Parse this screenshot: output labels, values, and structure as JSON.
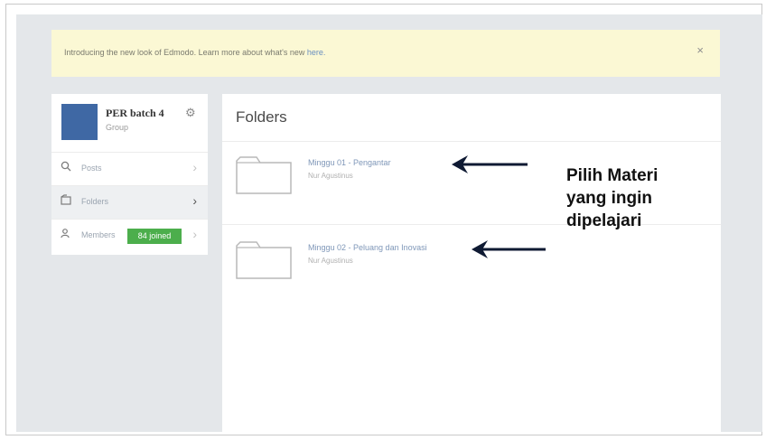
{
  "notice": {
    "text": "Introducing the new look of Edmodo. Learn more about what's new",
    "link": "here.",
    "close": "×"
  },
  "group": {
    "name": "PER batch 4",
    "type": "Group",
    "settings_icon": "gear-icon"
  },
  "nav": [
    {
      "label": "Posts",
      "icon": "search-icon",
      "active": false
    },
    {
      "label": "Folders",
      "icon": "folder-icon",
      "active": true
    },
    {
      "label": "Members",
      "icon": "members-icon",
      "badge": "84 joined",
      "active": false
    }
  ],
  "main": {
    "title": "Folders",
    "folders": [
      {
        "name": "Minggu 01 - Pengantar",
        "owner": "Nur Agustinus"
      },
      {
        "name": "Minggu 02 - Peluang dan Inovasi",
        "owner": "Nur Agustinus"
      }
    ]
  },
  "annotation": {
    "lines": [
      "Pilih Materi",
      "yang ingin",
      "dipelajari"
    ]
  },
  "colors": {
    "accent_blue": "#3f68a4",
    "badge_green": "#4cae4c",
    "notice_bg": "#fbf8d4",
    "app_bg": "#e4e7ea"
  }
}
